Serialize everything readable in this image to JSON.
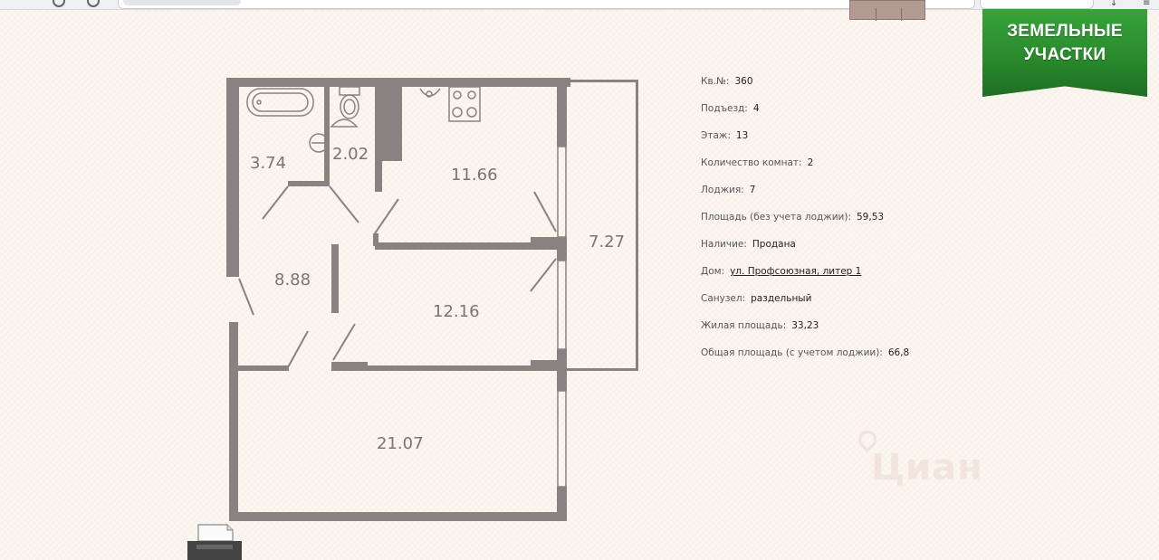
{
  "ribbon": {
    "line1": "ЗЕМЕЛЬНЫЕ",
    "line2": "УЧАСТКИ"
  },
  "rooms": {
    "bath": "3.74",
    "wc": "2.02",
    "kitchen": "11.66",
    "loggia": "7.27",
    "hall": "8.88",
    "room1": "12.16",
    "room2": "21.07"
  },
  "info": [
    {
      "label": "Кв.№:",
      "value": "360"
    },
    {
      "label": "Подъезд:",
      "value": "4"
    },
    {
      "label": "Этаж:",
      "value": "13"
    },
    {
      "label": "Количество комнат:",
      "value": "2"
    },
    {
      "label": "Лоджия:",
      "value": "7"
    },
    {
      "label": "Площадь (без учета лоджии):",
      "value": "59,53"
    },
    {
      "label": "Наличие:",
      "value": "Продана"
    },
    {
      "label": "Дом:",
      "value": "ул. Профсоюзная, литер 1"
    },
    {
      "label": "Санузел:",
      "value": "раздельный"
    },
    {
      "label": "Жилая площадь:",
      "value": "33,23"
    },
    {
      "label": "Общая площадь (с учетом лоджии):",
      "value": "66,8"
    }
  ],
  "colors": {
    "wall": "#8a8280",
    "ribbon": "#2a8a2d",
    "link": "#1a56c6"
  },
  "icons": [
    "printer-icon",
    "bathtub-icon",
    "toilet-icon",
    "sink-icon",
    "stove-icon",
    "cian-watermark-icon"
  ]
}
